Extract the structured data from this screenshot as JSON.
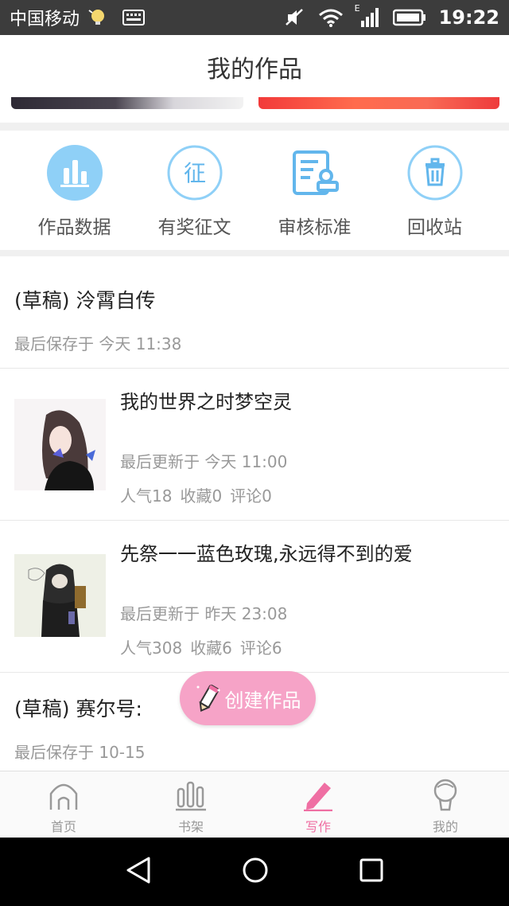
{
  "status_bar": {
    "carrier": "中国移动",
    "network_label": "E",
    "time": "19:22"
  },
  "header": {
    "title": "我的作品"
  },
  "actions": [
    {
      "label": "作品数据",
      "icon": "bar-chart-icon"
    },
    {
      "label": "有奖征文",
      "icon": "contest-icon"
    },
    {
      "label": "审核标准",
      "icon": "review-standard-icon"
    },
    {
      "label": "回收站",
      "icon": "trash-icon"
    }
  ],
  "works": {
    "draft1": {
      "title": "(草稿) 泠霄自传",
      "meta": "最后保存于 今天 11:38"
    },
    "work1": {
      "title": "我的世界之时梦空灵",
      "updated": "最后更新于 今天 11:00",
      "popularity": "人气18",
      "favorites": "收藏0",
      "comments": "评论0"
    },
    "work2": {
      "title": "先祭一一蓝色玫瑰,永远得不到的爱",
      "updated": "最后更新于 昨天 23:08",
      "popularity": "人气308",
      "favorites": "收藏6",
      "comments": "评论6"
    },
    "draft2": {
      "title": "(草稿) 赛尔号:",
      "meta": "最后保存于 10-15"
    }
  },
  "fab": {
    "label": "创建作品"
  },
  "bottom_nav": [
    {
      "label": "首页",
      "icon": "home-icon",
      "active": false
    },
    {
      "label": "书架",
      "icon": "bookshelf-icon",
      "active": false
    },
    {
      "label": "写作",
      "icon": "pencil-icon",
      "active": true
    },
    {
      "label": "我的",
      "icon": "profile-icon",
      "active": false
    }
  ],
  "colors": {
    "accent_blue": "#62b6ec",
    "accent_pink": "#ef6fa3",
    "fab_pink": "#f6a3c7",
    "status_bar": "#3c3c3c"
  }
}
